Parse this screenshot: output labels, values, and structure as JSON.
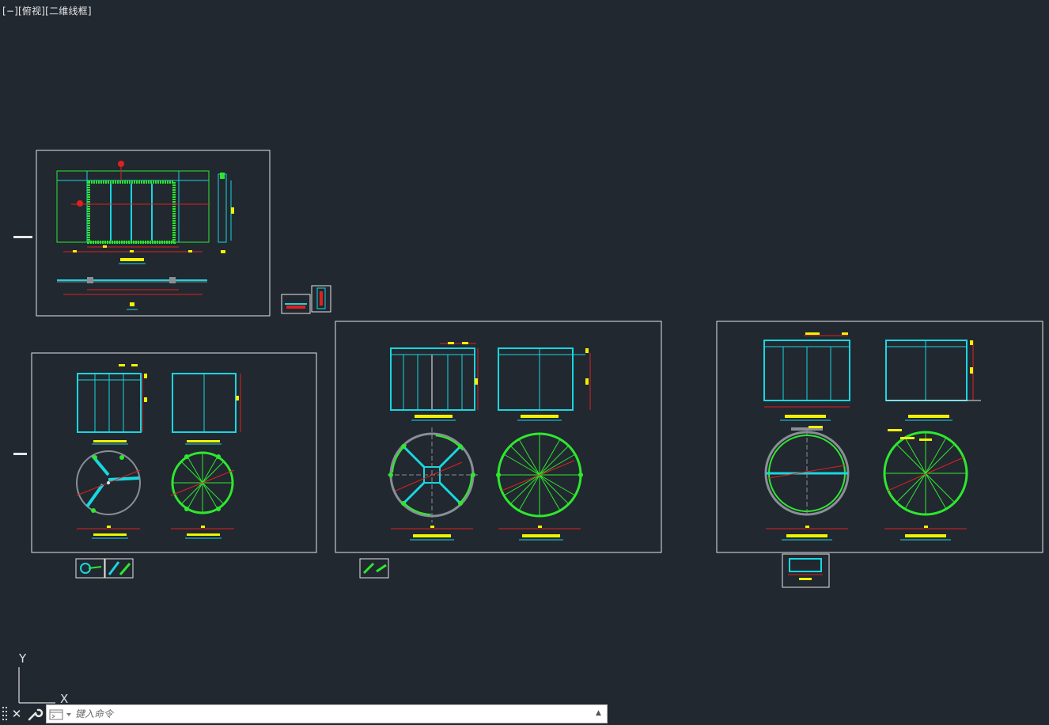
{
  "viewport": {
    "label": "[−][俯视][二维线框]"
  },
  "ucs": {
    "y_label": "Y",
    "x_label": "X"
  },
  "command_line": {
    "placeholder": "键入命令",
    "close_icon": "close-icon",
    "tools_icon": "wrench-icon",
    "history_icon": "command-history-icon"
  },
  "colors": {
    "background": "#212830",
    "frame": "#e6e6e6",
    "cyan": "#19d6e0",
    "green": "#2ee82e",
    "red": "#e02020",
    "yellow": "#f2f200",
    "gray": "#8a8f96"
  }
}
